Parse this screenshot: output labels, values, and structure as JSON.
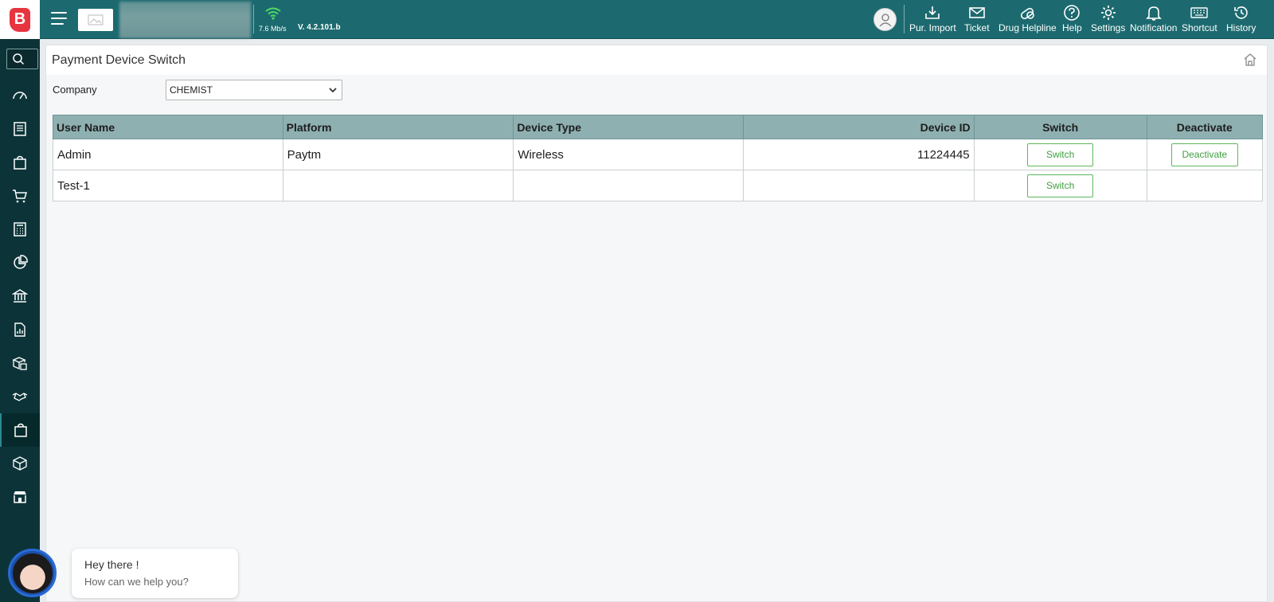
{
  "header": {
    "speed": "7.6 Mb/s",
    "version": "V. 4.2.101.b",
    "actions": [
      {
        "label": "Pur. Import",
        "icon": "download-icon"
      },
      {
        "label": "Ticket",
        "icon": "mail-icon"
      },
      {
        "label": "Drug Helpline",
        "icon": "pill-icon"
      },
      {
        "label": "Help",
        "icon": "help-icon"
      },
      {
        "label": "Settings",
        "icon": "gear-icon"
      },
      {
        "label": "Notification",
        "icon": "bell-icon"
      },
      {
        "label": "Shortcut",
        "icon": "keyboard-icon"
      },
      {
        "label": "History",
        "icon": "history-icon"
      }
    ]
  },
  "sidebar": {
    "items": [
      "dashboard-icon",
      "ledger-icon",
      "bag-icon",
      "cart-icon",
      "calculator-icon",
      "pie-chart-icon",
      "bank-icon",
      "report-icon",
      "inventory-icon",
      "handshake-icon",
      "shopping-bag-icon",
      "box-icon",
      "store-icon"
    ],
    "active_index": 10
  },
  "page": {
    "title": "Payment Device Switch",
    "company_label": "Company",
    "company_value": "CHEMIST"
  },
  "table": {
    "headers": [
      "User Name",
      "Platform",
      "Device Type",
      "Device ID",
      "Switch",
      "Deactivate"
    ],
    "rows": [
      {
        "user": "Admin",
        "platform": "Paytm",
        "device_type": "Wireless",
        "device_id": "11224445",
        "switch": "Switch",
        "deactivate": "Deactivate"
      },
      {
        "user": "Test-1",
        "platform": "",
        "device_type": "",
        "device_id": "",
        "switch": "Switch",
        "deactivate": ""
      }
    ]
  },
  "chat": {
    "greeting": "Hey there !",
    "prompt": "How can we help you?"
  },
  "colors": {
    "topbar": "#1c6a6f",
    "sidebar": "#0c3438",
    "table_header": "#8fb0b1",
    "button_green": "#5cb85c",
    "logo_red": "#e7343f"
  }
}
